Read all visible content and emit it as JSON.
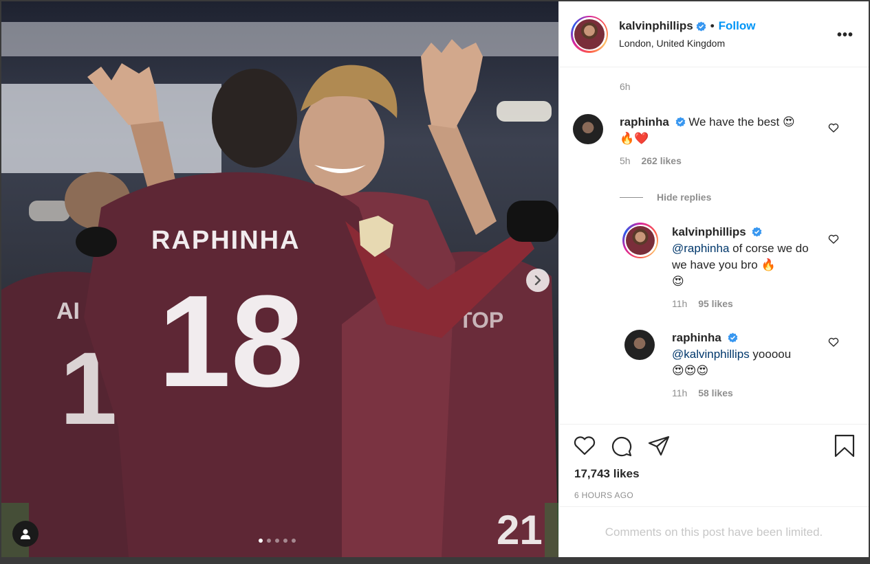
{
  "post": {
    "username": "kalvinphillips",
    "follow_label": "Follow",
    "bullet": "•",
    "location": "London, United Kingdom",
    "more_label": "•••",
    "time_top": "6h",
    "likes": "17,743 likes",
    "time_ago": "6 HOURS AGO",
    "comments_limited": "Comments on this post have been limited.",
    "photo_jersey_name": "RAPHINHA",
    "photo_jersey_number": "18",
    "carousel_dots": 5,
    "carousel_active": 1
  },
  "comments": {
    "c1": {
      "username": "raphinha",
      "text": "We have the best",
      "emoji_line1": "😍",
      "emoji_line2": "🔥❤️",
      "time": "5h",
      "likes": "262 likes"
    },
    "hide_replies": "Hide replies",
    "r1": {
      "username": "kalvinphillips",
      "mention": "@raphinha",
      "text": " of corse we do we have you bro ",
      "emoji_inline": "🔥",
      "emoji_line2": "😍",
      "time": "11h",
      "likes": "95 likes"
    },
    "r2": {
      "username": "raphinha",
      "mention": "@kalvinphillips",
      "text": " yoooou",
      "emoji_line2": "😍😍😍",
      "time": "11h",
      "likes": "58 likes"
    }
  },
  "colors": {
    "accent": "#0095f6",
    "verified": "#3897f0",
    "jersey": "#5e2735"
  }
}
